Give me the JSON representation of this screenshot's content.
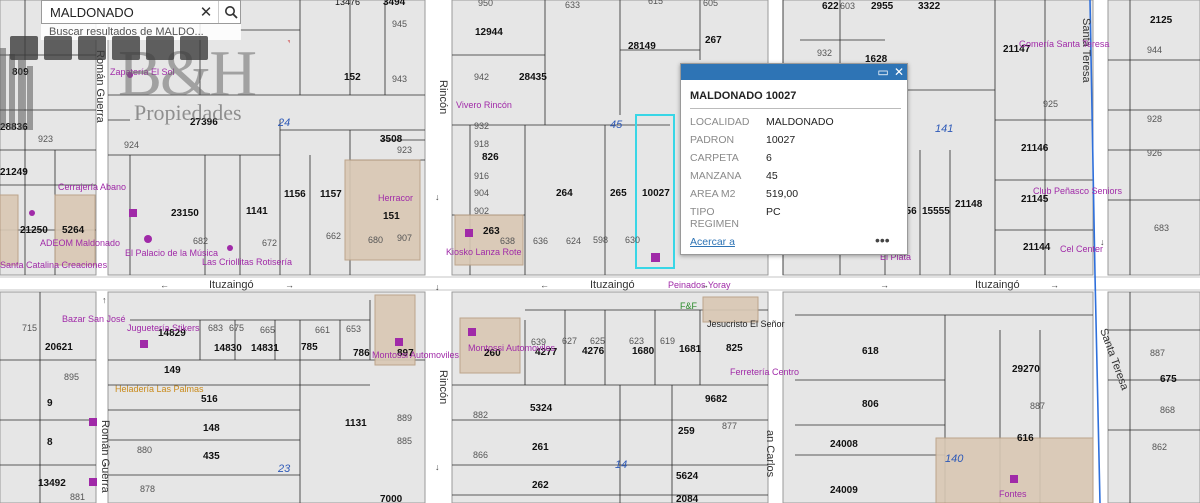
{
  "search": {
    "value": "MALDONADO",
    "suggestion": "Buscar resultados de MALDO..."
  },
  "watermark": {
    "brand": "B&H",
    "subtitle": "Propiedades"
  },
  "popup": {
    "title": "MALDONADO 10027",
    "rows": [
      {
        "key": "LOCALIDAD",
        "value": "MALDONADO"
      },
      {
        "key": "PADRON",
        "value": "10027"
      },
      {
        "key": "CARPETA",
        "value": "6"
      },
      {
        "key": "MANZANA",
        "value": "45"
      },
      {
        "key": "AREA M2",
        "value": "519,00"
      },
      {
        "key": "TIPO REGIMEN",
        "value": "PC"
      }
    ],
    "zoom_link": "Acercar a",
    "more": "•••"
  },
  "streets": {
    "ituzaingo": "Ituzaingó",
    "rincon": "Rincón",
    "roman_guerra": "Román Guerra",
    "santa_teresa": "Santa Teresa",
    "san_carlos": "an Carlos"
  },
  "blocks": [
    "24",
    "45",
    "141",
    "23",
    "14",
    "140"
  ],
  "parcels": [
    "13476",
    "3494",
    "945",
    "809",
    "152",
    "943",
    "28836",
    "923",
    "924",
    "27396",
    "21249",
    "21250",
    "5264",
    "23150",
    "1141",
    "1156",
    "1157",
    "3508",
    "923",
    "151",
    "907",
    "680",
    "662",
    "682",
    "672",
    "950",
    "633",
    "615",
    "12944",
    "28149",
    "267",
    "605",
    "942",
    "28435",
    "932",
    "918",
    "826",
    "916",
    "264",
    "265",
    "10027",
    "904",
    "902",
    "263",
    "638",
    "636",
    "624",
    "598",
    "630",
    "622",
    "603",
    "2955",
    "3322",
    "2125",
    "944",
    "932",
    "1628",
    "21147",
    "925",
    "928",
    "926",
    "21146",
    "21145",
    "21148",
    "15555",
    "256",
    "21144",
    "683",
    "715",
    "20621",
    "895",
    "14829",
    "683",
    "675",
    "665",
    "661",
    "653",
    "14830",
    "14831",
    "785",
    "786",
    "897",
    "149",
    "516",
    "9",
    "148",
    "1131",
    "8",
    "435",
    "889",
    "885",
    "13492",
    "880",
    "878",
    "881",
    "260",
    "639",
    "627",
    "625",
    "623",
    "619",
    "4277",
    "4276",
    "1680",
    "1681",
    "825",
    "5324",
    "9682",
    "882",
    "261",
    "259",
    "877",
    "866",
    "262",
    "5624",
    "2084",
    "7000",
    "618",
    "29270",
    "806",
    "887",
    "24008",
    "616",
    "24009",
    "675",
    "868",
    "862",
    "887"
  ],
  "places": [
    "Zapatería El Sol",
    "Cerrajería Abano",
    "ADEOM Maldonado",
    "Santa Catalina Creaciones",
    "El Palacio de la Música",
    "Las Criollitas Rotisería",
    "Herracor",
    "Vivero Rincón",
    "Kiosko Lanza Rote",
    "Peinados Yoray",
    "F&F",
    "Gomería Santa Teresa",
    "Club Peñasco Seniors",
    "Cel Center",
    "El Plata",
    "Bazar San José",
    "Juguetería Stikers",
    "Heladería Las Palmas",
    "Montossi Automoviles",
    "Montossi Automoviles",
    "Jesucristo El Señor",
    "Ferretería Centro",
    "Fontes"
  ]
}
